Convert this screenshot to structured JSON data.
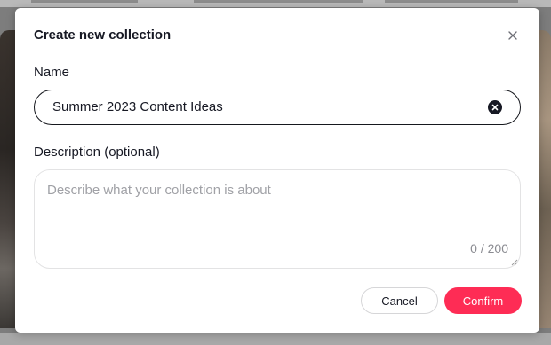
{
  "dialog": {
    "title": "Create new collection",
    "name_label": "Name",
    "name_value": "Summer 2023 Content Ideas",
    "description_label": "Description (optional)",
    "description_placeholder": "Describe what your collection is about",
    "description_value": "",
    "char_count": "0 / 200",
    "cancel_label": "Cancel",
    "confirm_label": "Confirm"
  },
  "icons": {
    "close": "close-icon",
    "clear": "clear-input-icon",
    "resize": "resize-handle-icon"
  },
  "colors": {
    "accent": "#fe2c55",
    "text": "#161823",
    "placeholder": "#a0a1a6",
    "overlay": "#7d7d7d"
  }
}
